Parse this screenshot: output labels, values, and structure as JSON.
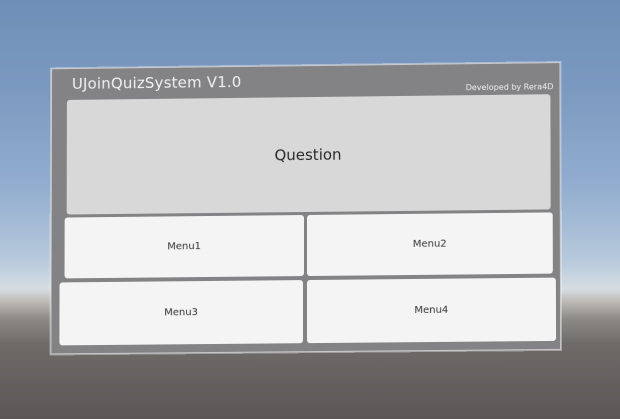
{
  "panel": {
    "title": "UJoinQuizSystem V1.0",
    "developer": "Developed by Rera4D"
  },
  "question": {
    "text": "Question"
  },
  "menus": [
    {
      "label": "Menu1"
    },
    {
      "label": "Menu2"
    },
    {
      "label": "Menu3"
    },
    {
      "label": "Menu4"
    }
  ]
}
